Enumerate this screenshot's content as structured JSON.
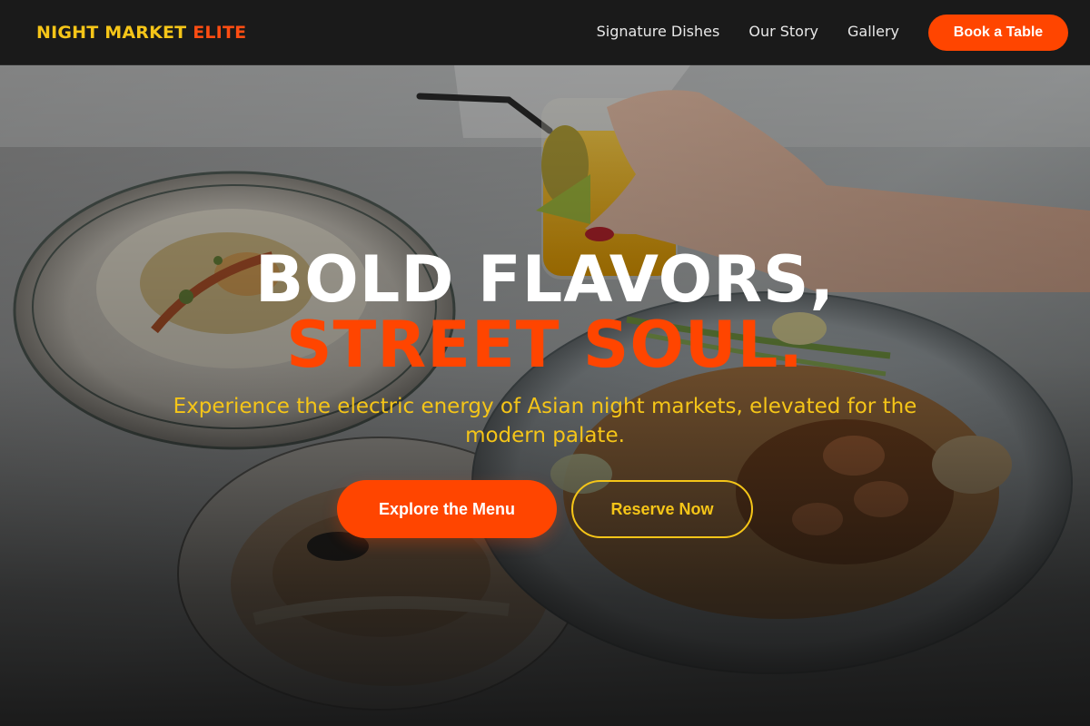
{
  "nav": {
    "brand_primary": "NIGHT MARKET",
    "brand_accent": "ELITE",
    "links": [
      {
        "label": "Signature Dishes"
      },
      {
        "label": "Our Story"
      },
      {
        "label": "Gallery"
      }
    ],
    "cta_label": "Book a Table"
  },
  "hero": {
    "title_line1": "BOLD FLAVORS,",
    "title_line2": "STREET SOUL.",
    "subtitle": "Experience the electric energy of Asian night markets, elevated for the modern palate.",
    "primary_button": "Explore the Menu",
    "secondary_button": "Reserve Now"
  },
  "colors": {
    "accent_orange": "#ff4500",
    "accent_yellow": "#f5c518",
    "nav_background": "#1a1a1a",
    "page_background": "#141414"
  },
  "icons": []
}
